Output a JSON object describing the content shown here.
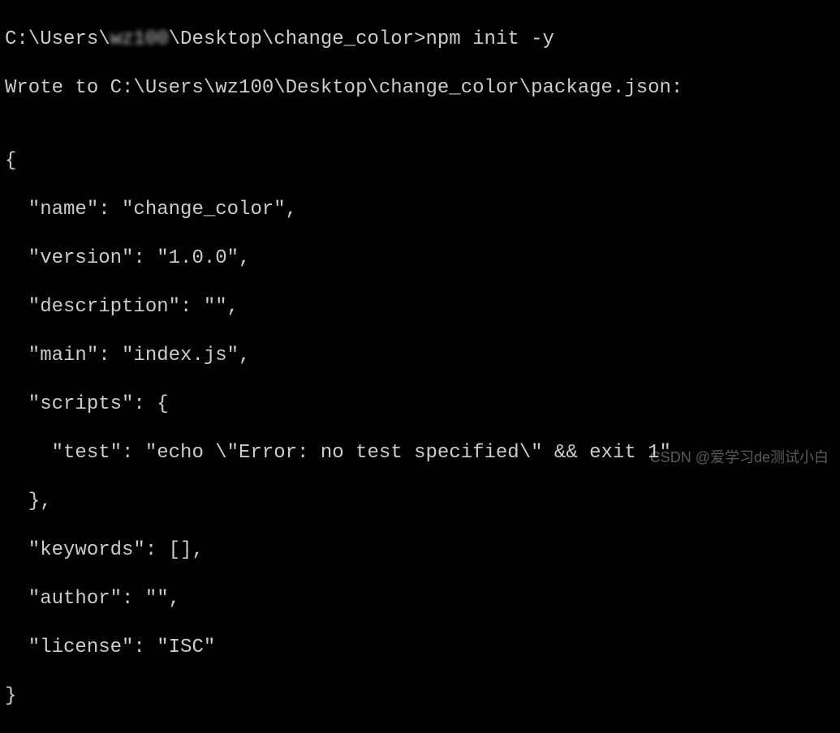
{
  "prompt": {
    "path_prefix": "C:\\Users\\",
    "username_blurred": "wz100",
    "path_suffix": "\\Desktop\\change_color>",
    "command": "npm init -y"
  },
  "output": {
    "wrote_line": "Wrote to C:\\Users\\wz100\\Desktop\\change_color\\package.json:",
    "blank1": "",
    "json_open": "{",
    "name_line": "  \"name\": \"change_color\",",
    "version_line": "  \"version\": \"1.0.0\",",
    "description_line": "  \"description\": \"\",",
    "main_line": "  \"main\": \"index.js\",",
    "scripts_open": "  \"scripts\": {",
    "test_line": "    \"test\": \"echo \\\"Error: no test specified\\\" && exit 1\"",
    "scripts_close": "  },",
    "keywords_line": "  \"keywords\": [],",
    "author_line": "  \"author\": \"\",",
    "license_line": "  \"license\": \"ISC\"",
    "json_close": "}"
  },
  "watermark": "CSDN @爱学习de测试小白"
}
